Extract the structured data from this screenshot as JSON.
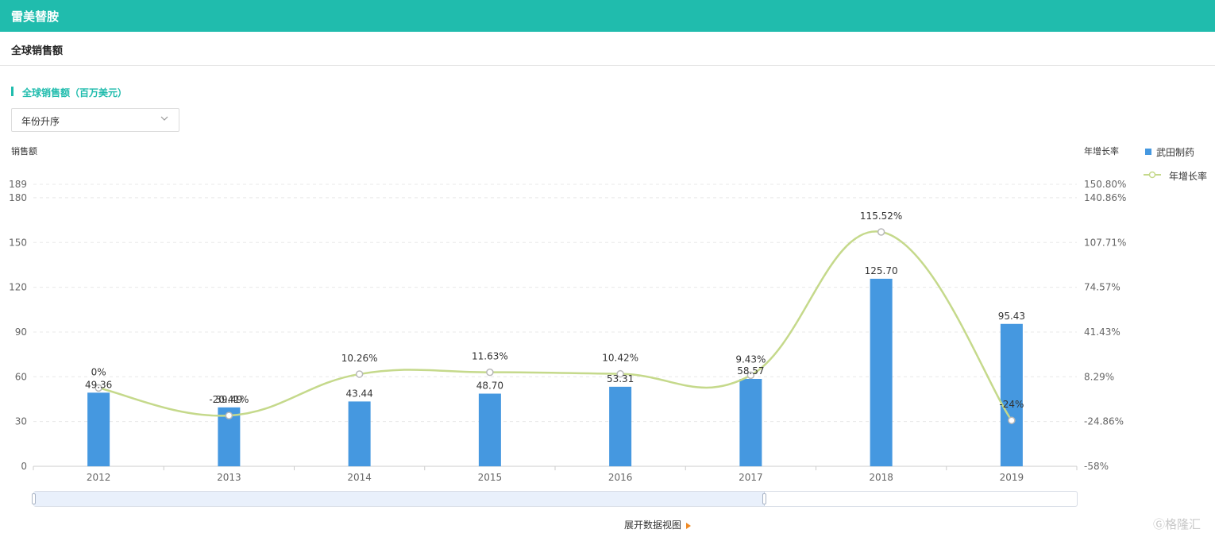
{
  "header": {
    "title": "雷美替胺"
  },
  "subheader": {
    "title": "全球销售额"
  },
  "section": {
    "title": "全球销售额（百万美元）"
  },
  "sort": {
    "selected": "年份升序"
  },
  "axes": {
    "left_title": "销售额",
    "right_title": "年增长率"
  },
  "legend": {
    "bar_label": "武田制药",
    "line_label": "年增长率"
  },
  "colors": {
    "accent": "#20bcad",
    "bar": "#4598e0",
    "line": "#c5d98b"
  },
  "footer": {
    "expand_label": "展开数据视图"
  },
  "watermark": {
    "text": "格隆汇"
  },
  "chart_data": {
    "type": "bar",
    "categories": [
      "2012",
      "2013",
      "2014",
      "2015",
      "2016",
      "2017",
      "2018",
      "2019"
    ],
    "series": [
      {
        "name": "武田制药",
        "type": "bar",
        "axis": "left",
        "values": [
          49.36,
          39.49,
          43.44,
          48.7,
          53.31,
          58.57,
          125.7,
          95.43
        ],
        "labels": [
          "49.36",
          "39.49",
          "43.44",
          "48.70",
          "53.31",
          "58.57",
          "125.70",
          "95.43"
        ]
      },
      {
        "name": "年增长率",
        "type": "line",
        "axis": "right",
        "smooth": true,
        "values": [
          0,
          -20.41,
          10.26,
          11.63,
          10.42,
          9.43,
          115.52,
          -24
        ],
        "labels": [
          "0%",
          "-20.41%",
          "10.26%",
          "11.63%",
          "10.42%",
          "9.43%",
          "115.52%",
          "-24%"
        ]
      }
    ],
    "y_left": {
      "title": "销售额",
      "ylim": [
        0,
        189
      ],
      "ticks": [
        0,
        30,
        60,
        90,
        120,
        150,
        180,
        189
      ],
      "tick_labels": [
        "0",
        "30",
        "60",
        "90",
        "120",
        "150",
        "180",
        "189"
      ]
    },
    "y_right": {
      "title": "年增长率",
      "ylim": [
        -58,
        150.8
      ],
      "ticks": [
        -58,
        -24.86,
        8.29,
        41.43,
        74.57,
        107.71,
        140.86,
        150.8
      ],
      "tick_labels": [
        "-58%",
        "-24.86%",
        "8.29%",
        "41.43%",
        "74.57%",
        "107.71%",
        "140.86%",
        "150.80%"
      ]
    },
    "grid": true,
    "legend_position": "top-right"
  }
}
